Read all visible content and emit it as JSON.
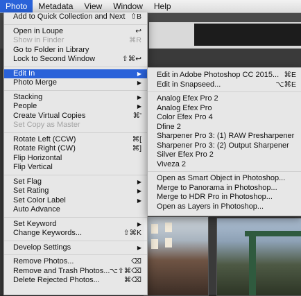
{
  "menubar": {
    "items": [
      "Photo",
      "Metadata",
      "View",
      "Window",
      "Help"
    ],
    "active": "Photo"
  },
  "photo_menu": {
    "items": [
      {
        "label": "Add to Quick Collection and Next",
        "shortcut": "⇧B"
      },
      {
        "sep": true
      },
      {
        "label": "Open in Loupe",
        "shortcut": "↩"
      },
      {
        "label": "Show in Finder",
        "shortcut": "⌘R",
        "disabled": true
      },
      {
        "label": "Go to Folder in Library",
        "shortcut": ""
      },
      {
        "label": "Lock to Second Window",
        "shortcut": "⇧⌘↩"
      },
      {
        "sep": true
      },
      {
        "label": "Edit In",
        "submenu": true,
        "highlight": true
      },
      {
        "label": "Photo Merge",
        "submenu": true
      },
      {
        "sep": true
      },
      {
        "label": "Stacking",
        "submenu": true
      },
      {
        "label": "People",
        "submenu": true
      },
      {
        "label": "Create Virtual Copies",
        "shortcut": "⌘'"
      },
      {
        "label": "Set Copy as Master",
        "disabled": true
      },
      {
        "sep": true
      },
      {
        "label": "Rotate Left (CCW)",
        "shortcut": "⌘["
      },
      {
        "label": "Rotate Right (CW)",
        "shortcut": "⌘]"
      },
      {
        "label": "Flip Horizontal",
        "shortcut": ""
      },
      {
        "label": "Flip Vertical",
        "shortcut": ""
      },
      {
        "sep": true
      },
      {
        "label": "Set Flag",
        "submenu": true
      },
      {
        "label": "Set Rating",
        "submenu": true
      },
      {
        "label": "Set Color Label",
        "submenu": true
      },
      {
        "label": "Auto Advance",
        "shortcut": ""
      },
      {
        "sep": true
      },
      {
        "label": "Set Keyword",
        "submenu": true
      },
      {
        "label": "Change Keywords...",
        "shortcut": "⇧⌘K"
      },
      {
        "sep": true
      },
      {
        "label": "Develop Settings",
        "submenu": true
      },
      {
        "sep": true
      },
      {
        "label": "Remove Photos...",
        "shortcut": "⌫"
      },
      {
        "label": "Remove and Trash Photos...",
        "shortcut": "⌥⇧⌘⌫"
      },
      {
        "label": "Delete Rejected Photos...",
        "shortcut": "⌘⌫"
      }
    ]
  },
  "edit_in_submenu": {
    "items": [
      {
        "label": "Edit in Adobe Photoshop CC 2015...",
        "shortcut": "⌘E"
      },
      {
        "label": "Edit in Snapseed...",
        "shortcut": "⌥⌘E"
      },
      {
        "sep": true
      },
      {
        "label": "Analog Efex Pro 2"
      },
      {
        "label": "Analog Efex Pro"
      },
      {
        "label": "Color Efex Pro 4"
      },
      {
        "label": "Dfine 2"
      },
      {
        "label": "Sharpener Pro 3: (1) RAW Presharpener"
      },
      {
        "label": "Sharpener Pro 3: (2) Output Sharpener"
      },
      {
        "label": "Silver Efex Pro 2"
      },
      {
        "label": "Viveza 2"
      },
      {
        "sep": true
      },
      {
        "label": "Open as Smart Object in Photoshop..."
      },
      {
        "label": "Merge to Panorama in Photoshop..."
      },
      {
        "label": "Merge to HDR Pro in Photoshop..."
      },
      {
        "label": "Open as Layers in Photoshop..."
      }
    ]
  },
  "colors": {
    "highlight": "#2a62d9",
    "menu_bg": "#ececec",
    "disabled": "#a3a3a3"
  }
}
